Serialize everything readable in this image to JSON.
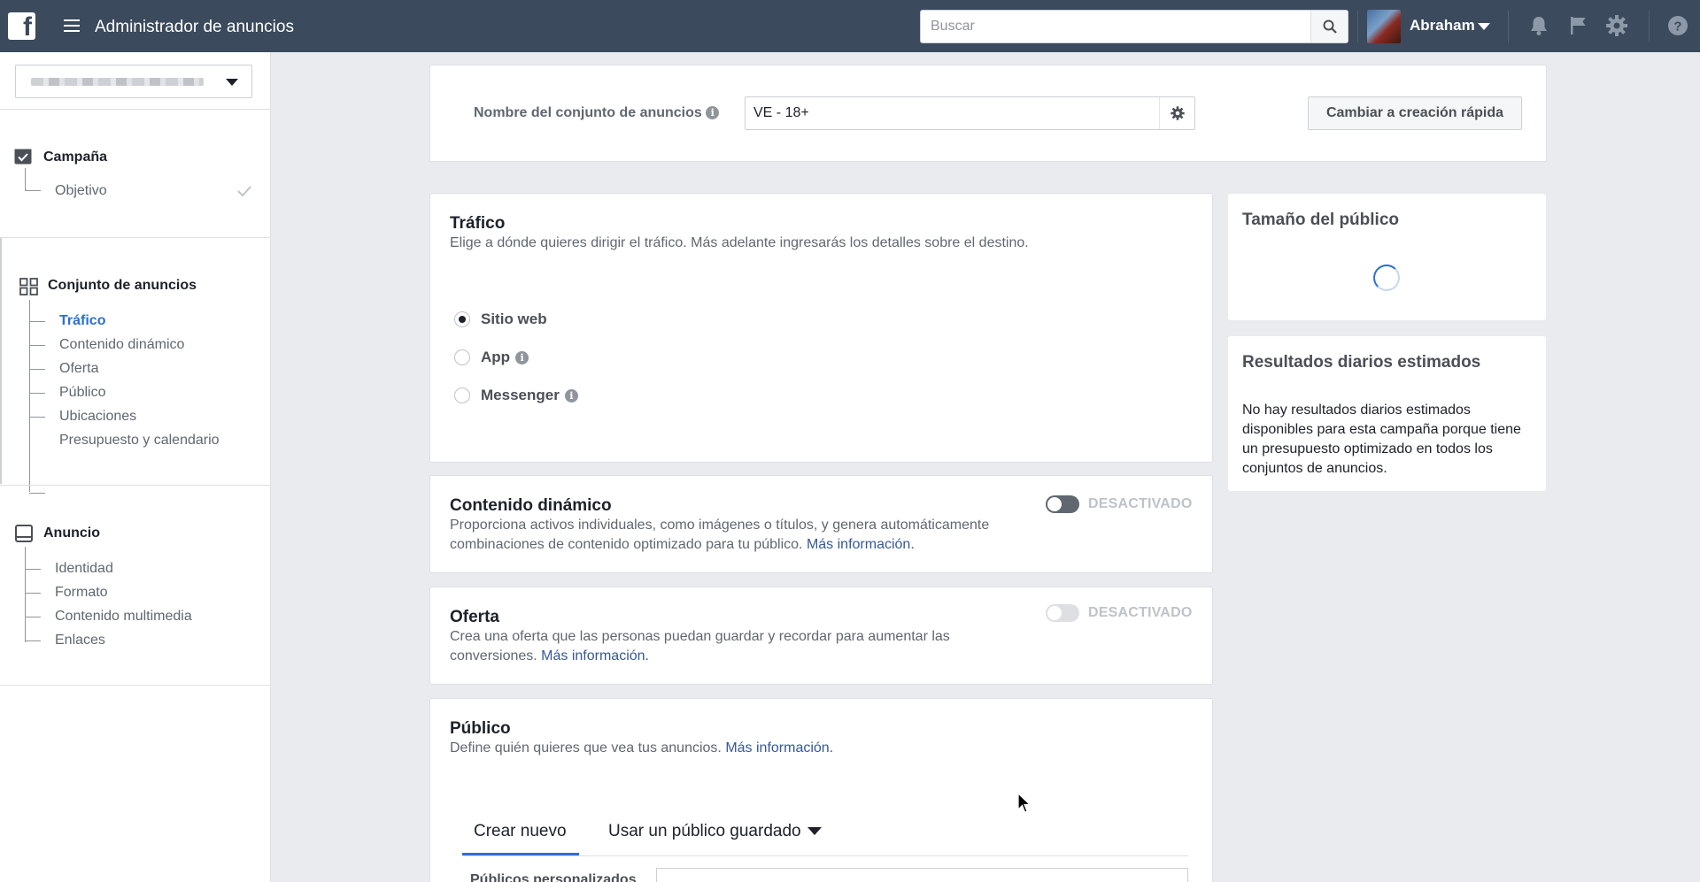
{
  "topbar": {
    "app_title": "Administrador de anuncios",
    "search_placeholder": "Buscar",
    "user_name": "Abraham"
  },
  "sidebar": {
    "sections": [
      {
        "title": "Campaña",
        "items": [
          {
            "label": "Objetivo",
            "complete": true
          }
        ]
      },
      {
        "title": "Conjunto de anuncios",
        "items": [
          {
            "label": "Tráfico",
            "active": true
          },
          {
            "label": "Contenido dinámico"
          },
          {
            "label": "Oferta"
          },
          {
            "label": "Público"
          },
          {
            "label": "Ubicaciones"
          },
          {
            "label": "Presupuesto y calendario"
          }
        ]
      },
      {
        "title": "Anuncio",
        "items": [
          {
            "label": "Identidad"
          },
          {
            "label": "Formato"
          },
          {
            "label": "Contenido multimedia"
          },
          {
            "label": "Enlaces"
          }
        ]
      }
    ]
  },
  "adset_name": {
    "label": "Nombre del conjunto de anuncios",
    "value": "VE - 18+",
    "quick_create_button": "Cambiar a creación rápida"
  },
  "traffic": {
    "title": "Tráfico",
    "description": "Elige a dónde quieres dirigir el tráfico. Más adelante ingresarás los detalles sobre el destino.",
    "options": [
      {
        "label": "Sitio web",
        "selected": true,
        "info": false
      },
      {
        "label": "App",
        "selected": false,
        "info": true
      },
      {
        "label": "Messenger",
        "selected": false,
        "info": true
      }
    ]
  },
  "dynamic_content": {
    "title": "Contenido dinámico",
    "description": "Proporciona activos individuales, como imágenes o títulos, y genera automáticamente combinaciones de contenido optimizado para tu público.",
    "link": "Más información.",
    "toggle_label": "DESACTIVADO",
    "enabled": false
  },
  "offer": {
    "title": "Oferta",
    "description": "Crea una oferta que las personas puedan guardar y recordar para aumentar las conversiones.",
    "link": "Más información.",
    "toggle_label": "DESACTIVADO",
    "enabled": false
  },
  "audience": {
    "title": "Público",
    "description": "Define quién quieres que vea tus anuncios.",
    "link": "Más información.",
    "tabs": [
      "Crear nuevo",
      "Usar un público guardado"
    ],
    "active_tab": 0,
    "custom_audiences_label": "Públicos personalizados"
  },
  "audience_size": {
    "title": "Tamaño del público"
  },
  "daily_results": {
    "title": "Resultados diarios estimados",
    "body": "No hay resultados diarios estimados disponibles para esta campaña porque tiene un presupuesto optimizado en todos los conjuntos de anuncios."
  },
  "colors": {
    "topbar": "#3b4a5c",
    "accent": "#2d6fd1",
    "link": "#365899"
  }
}
